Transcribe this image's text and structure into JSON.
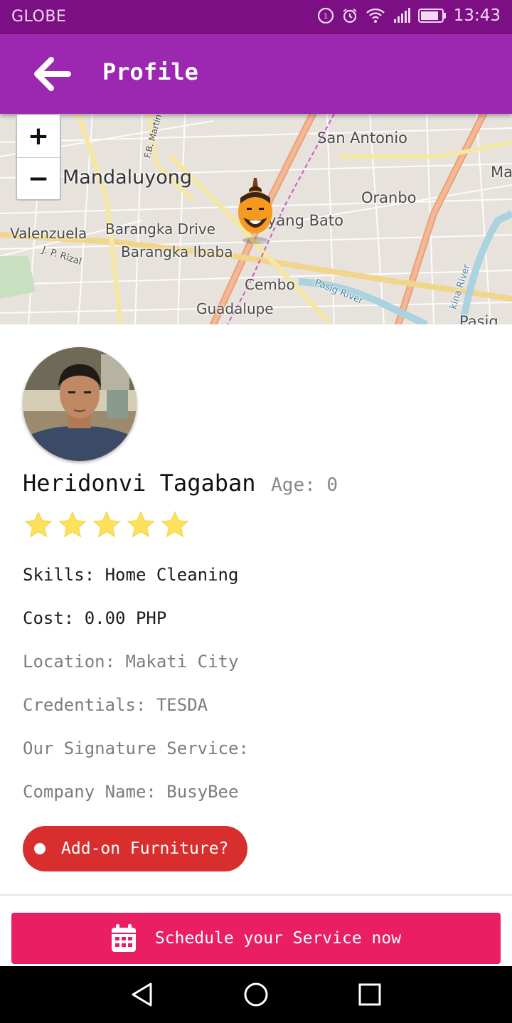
{
  "status_bar": {
    "carrier": "GLOBE",
    "time": "13:43"
  },
  "app_bar": {
    "title": "Profile",
    "back_icon": "arrow-left-icon"
  },
  "map": {
    "labels": {
      "san_antonio": "San Antonio",
      "ma": "Ma",
      "mandaluyong": "Mandaluyong",
      "oranbo": "Oranbo",
      "pineda": "yang Bato",
      "valenzuela": "Valenzuela",
      "barangka_drive": "Barangka Drive",
      "barangka_ibaba": "Barangka Ibaba",
      "jp_rizal": "J. P. Rizal",
      "cembo": "Cembo",
      "guadalupe": "Guadalupe",
      "fb_martin": "F.B. Martin",
      "pasig_river": "Pasig River",
      "marikina_river": "kina River",
      "pasig": "Pasig"
    },
    "zoom_in": "+",
    "zoom_out": "−"
  },
  "profile": {
    "name": "Heridonvi Tagaban",
    "age": "Age: 0",
    "rating": 5,
    "rating_max": 5,
    "skills": "Skills: Home Cleaning",
    "cost": "Cost: 0.00 PHP",
    "location": "Location: Makati City",
    "credentials": "Credentials: TESDA",
    "signature_service": "Our Signature Service:",
    "company": "Company Name: BusyBee"
  },
  "addon_button": {
    "label": "Add-on Furniture?"
  },
  "schedule_button": {
    "label": "Schedule your Service now",
    "icon": "calendar-icon"
  },
  "colors": {
    "status_bar": "#7b0f83",
    "app_bar": "#9c27b0",
    "addon": "#d92e2e",
    "schedule": "#e91e63",
    "star": "#fde15a"
  }
}
